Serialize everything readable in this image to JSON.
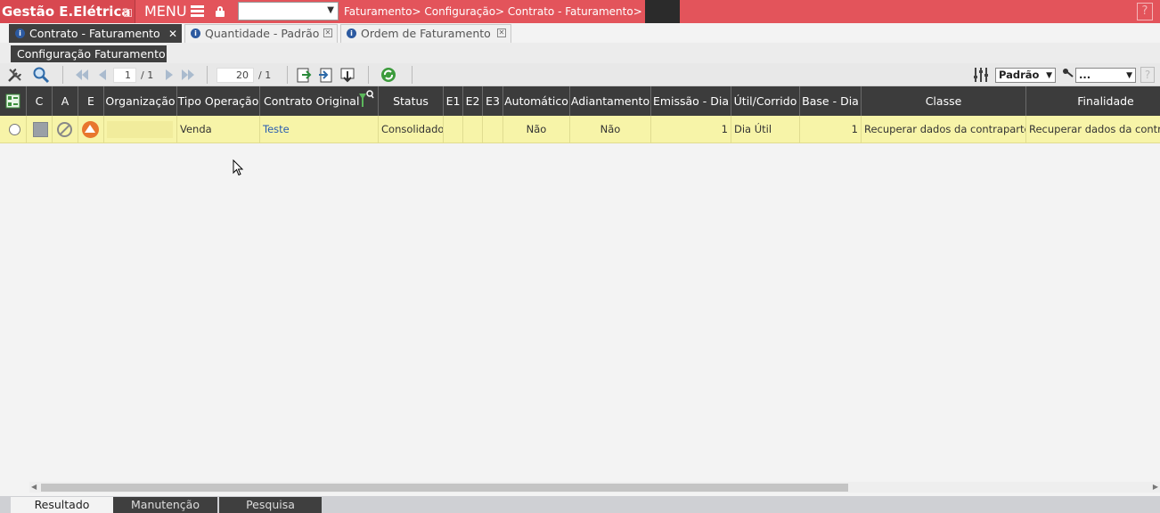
{
  "topbar": {
    "app_title": "Gestão E.Elétrica",
    "menu_label": "MENU",
    "breadcrumb": "Faturamento>  Configuração>  Contrato - Faturamento>",
    "help_label": "?",
    "select_value": ""
  },
  "tabs": [
    {
      "label": "Contrato - Faturamento",
      "active": true
    },
    {
      "label": "Quantidade - Padrão",
      "active": false
    },
    {
      "label": "Ordem de Faturamento",
      "active": false
    }
  ],
  "subtab": {
    "label": "Configuração Faturamento"
  },
  "toolbar": {
    "page_current": "1",
    "page_total": "/ 1",
    "page_size": "20",
    "page_size_total": "/ 1",
    "layout_select": "Padrão",
    "filter_select": "...",
    "help_label": "?"
  },
  "grid": {
    "headers": [
      "C",
      "A",
      "E",
      "Organização",
      "Tipo Operação",
      "Contrato Original",
      "Status",
      "E1",
      "E2",
      "E3",
      "Automático",
      "Adiantamento",
      "Emissão - Dia",
      "Útil/Corrido",
      "Base - Dia",
      "Classe",
      "Finalidade"
    ],
    "row": {
      "tipo_operacao": "Venda",
      "contrato_original": "Teste",
      "status": "Consolidado",
      "automatico": "Não",
      "adiantamento": "Não",
      "emissao_dia": "1",
      "util_corrido": "Dia Útil",
      "base_dia": "1",
      "classe": "Recuperar dados da contraparte",
      "finalidade": "Recuperar dados da contraparte"
    }
  },
  "bottom_tabs": [
    {
      "label": "Resultado",
      "active": true
    },
    {
      "label": "Manutenção",
      "active": false
    },
    {
      "label": "Pesquisa",
      "active": false
    }
  ],
  "colors": {
    "topbar": "#e3545b",
    "header_dark": "#3c3c3c",
    "row_highlight": "#f7f4a8",
    "link": "#2a5db0"
  }
}
